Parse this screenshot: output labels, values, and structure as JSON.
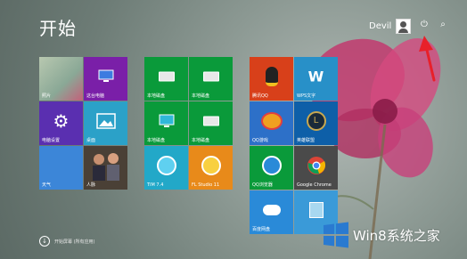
{
  "start": {
    "title": "开始"
  },
  "user": {
    "name": "Devil"
  },
  "icons": {
    "power": "power-icon",
    "search": "search-icon"
  },
  "tiles": {
    "photos": {
      "label": "照片"
    },
    "computer": {
      "label": "这台电脑"
    },
    "settings": {
      "label": "电脑设置"
    },
    "desktop": {
      "label": "桌面"
    },
    "weather": {
      "label": "天气"
    },
    "people": {
      "label": "人脉"
    },
    "disk1": {
      "label": "本地磁盘"
    },
    "disk2": {
      "label": "本地磁盘"
    },
    "disk3": {
      "label": "本地磁盘"
    },
    "disk4": {
      "label": "本地磁盘"
    },
    "tim": {
      "label": "TIM 7.4"
    },
    "fstudio": {
      "label": "FL Studio 11"
    },
    "qq": {
      "label": "腾讯QQ"
    },
    "wps": {
      "label": "WPS文字"
    },
    "qqgame": {
      "label": "QQ游戏"
    },
    "lol": {
      "label": "英雄联盟"
    },
    "browser": {
      "label": "QQ浏览器"
    },
    "chrome": {
      "label": "Google Chrome"
    },
    "baidu": {
      "label": "百度网盘"
    },
    "calc": {
      "label": ""
    }
  },
  "footer": {
    "text": "开始屏幕 (所有应用)"
  },
  "watermark": {
    "text": "Win8系统之家"
  },
  "colors": {
    "accent_arrow": "#e8202a"
  }
}
